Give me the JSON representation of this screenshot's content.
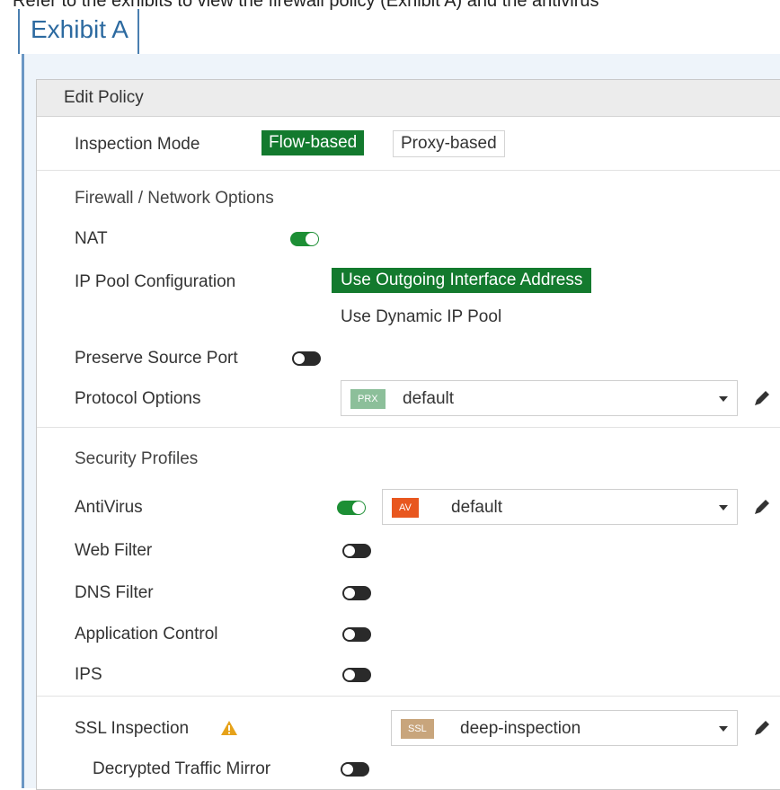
{
  "header_text": "Refer to the exhibits to view the firewall policy (Exhibit A) and the antivirus",
  "exhibit_tab": "Exhibit A",
  "panel_title": "Edit Policy",
  "inspection_mode": {
    "label": "Inspection Mode",
    "options": [
      "Flow-based",
      "Proxy-based"
    ],
    "selected": "Flow-based"
  },
  "firewall_section": "Firewall / Network Options",
  "nat": {
    "label": "NAT",
    "enabled": true
  },
  "ip_pool": {
    "label": "IP Pool Configuration",
    "options": [
      "Use Outgoing Interface Address",
      "Use Dynamic IP Pool"
    ],
    "selected": "Use Outgoing Interface Address"
  },
  "preserve_source_port": {
    "label": "Preserve Source Port",
    "enabled": false
  },
  "protocol_options": {
    "label": "Protocol Options",
    "badge": "PRX",
    "value": "default"
  },
  "security_section": "Security Profiles",
  "antivirus": {
    "label": "AntiVirus",
    "enabled": true,
    "badge": "AV",
    "value": "default"
  },
  "web_filter": {
    "label": "Web Filter",
    "enabled": false
  },
  "dns_filter": {
    "label": "DNS Filter",
    "enabled": false
  },
  "app_control": {
    "label": "Application Control",
    "enabled": false
  },
  "ips": {
    "label": "IPS",
    "enabled": false
  },
  "ssl_inspection": {
    "label": "SSL Inspection",
    "badge": "SSL",
    "value": "deep-inspection"
  },
  "decrypted_mirror": {
    "label": "Decrypted Traffic Mirror",
    "enabled": false
  },
  "colors": {
    "selected_green": "#137a2e",
    "toggle_on": "#1d8f35",
    "av_badge": "#e8571f",
    "prx_badge": "#8cbf9a",
    "ssl_badge": "#c8a57c",
    "warning": "#e6a21a"
  },
  "icons": [
    "pencil-icon",
    "warning-icon",
    "chevron-down-icon"
  ]
}
